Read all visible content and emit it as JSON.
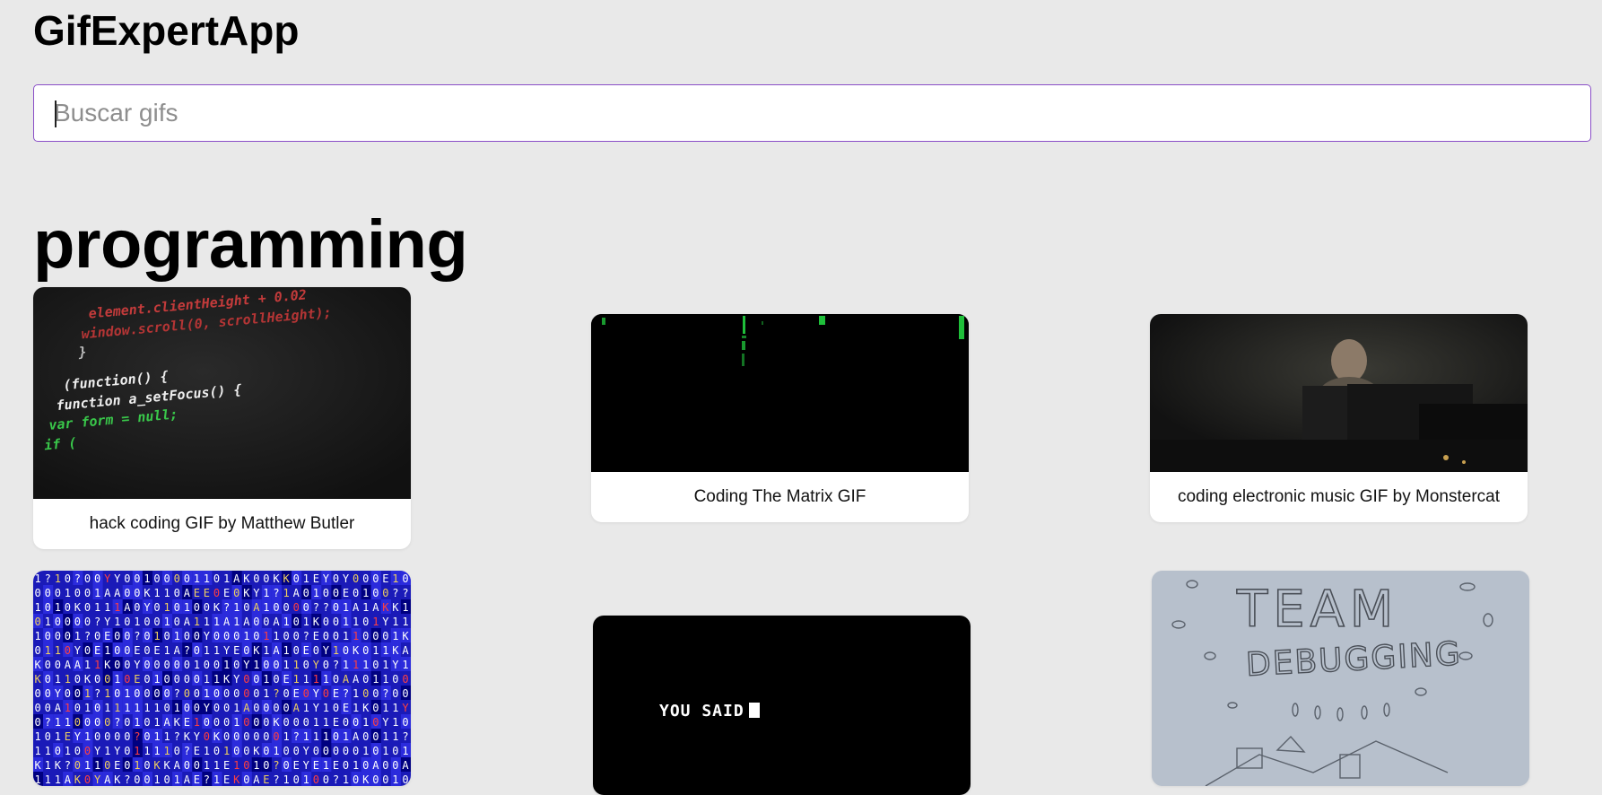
{
  "app": {
    "title": "GifExpertApp"
  },
  "search": {
    "placeholder": "Buscar gifs"
  },
  "category": {
    "title": "programming"
  },
  "gifs": [
    {
      "caption": "hack coding GIF by Matthew Butler",
      "code_lines": [
        "element.clientHeight + 0.02",
        "window.scroll(0, scrollHeight);",
        "}",
        "(function() {",
        "function a_setFocus() {",
        "var form = null;",
        "if ("
      ]
    },
    {
      "caption": "Coding The Matrix GIF"
    },
    {
      "caption": "coding electronic music GIF by Monstercat"
    },
    {
      "caption": ""
    },
    {
      "caption": "",
      "screen_text": "YOU SAID"
    },
    {
      "caption": "",
      "drawing_title_1": "TEAM",
      "drawing_title_2": "DEBUGGING"
    }
  ],
  "colors": {
    "background": "#e9e9e9",
    "input_border": "#8a4fc7",
    "card": "#ffffff"
  }
}
